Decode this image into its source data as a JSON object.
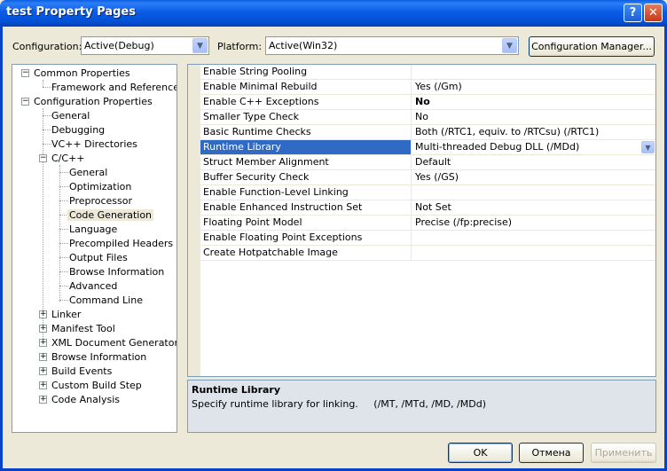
{
  "window": {
    "title": "test Property Pages",
    "help_glyph": "?",
    "close_glyph": "✕"
  },
  "toolbar": {
    "configuration_label": "Configuration:",
    "configuration_value": "Active(Debug)",
    "platform_label": "Platform:",
    "platform_value": "Active(Win32)",
    "config_manager_label": "Configuration Manager...",
    "dropdown_glyph": "▼"
  },
  "tree": {
    "expand_glyph": "+",
    "collapse_glyph": "−",
    "nodes": [
      {
        "label": "Common Properties"
      },
      {
        "label": "Framework and References"
      },
      {
        "label": "Configuration Properties"
      },
      {
        "label": "General"
      },
      {
        "label": "Debugging"
      },
      {
        "label": "VC++ Directories"
      },
      {
        "label": "C/C++"
      },
      {
        "label": "General"
      },
      {
        "label": "Optimization"
      },
      {
        "label": "Preprocessor"
      },
      {
        "label": "Code Generation",
        "selected": true
      },
      {
        "label": "Language"
      },
      {
        "label": "Precompiled Headers"
      },
      {
        "label": "Output Files"
      },
      {
        "label": "Browse Information"
      },
      {
        "label": "Advanced"
      },
      {
        "label": "Command Line"
      },
      {
        "label": "Linker"
      },
      {
        "label": "Manifest Tool"
      },
      {
        "label": "XML Document Generator"
      },
      {
        "label": "Browse Information"
      },
      {
        "label": "Build Events"
      },
      {
        "label": "Custom Build Step"
      },
      {
        "label": "Code Analysis"
      }
    ]
  },
  "properties": [
    {
      "name": "Enable String Pooling",
      "value": ""
    },
    {
      "name": "Enable Minimal Rebuild",
      "value": "Yes (/Gm)"
    },
    {
      "name": "Enable C++ Exceptions",
      "value": "No"
    },
    {
      "name": "Smaller Type Check",
      "value": "No"
    },
    {
      "name": "Basic Runtime Checks",
      "value": "Both (/RTC1, equiv. to /RTCsu) (/RTC1)"
    },
    {
      "name": "Runtime Library",
      "value": "Multi-threaded Debug DLL (/MDd)"
    },
    {
      "name": "Struct Member Alignment",
      "value": "Default"
    },
    {
      "name": "Buffer Security Check",
      "value": "Yes (/GS)"
    },
    {
      "name": "Enable Function-Level Linking",
      "value": ""
    },
    {
      "name": "Enable Enhanced Instruction Set",
      "value": "Not Set"
    },
    {
      "name": "Floating Point Model",
      "value": "Precise (/fp:precise)"
    },
    {
      "name": "Enable Floating Point Exceptions",
      "value": ""
    },
    {
      "name": "Create Hotpatchable Image",
      "value": ""
    }
  ],
  "description": {
    "title": "Runtime Library",
    "text": "Specify runtime library for linking.     (/MT, /MTd, /MD, /MDd)"
  },
  "buttons": {
    "ok": "OK",
    "cancel": "Отмена",
    "apply": "Применить"
  }
}
